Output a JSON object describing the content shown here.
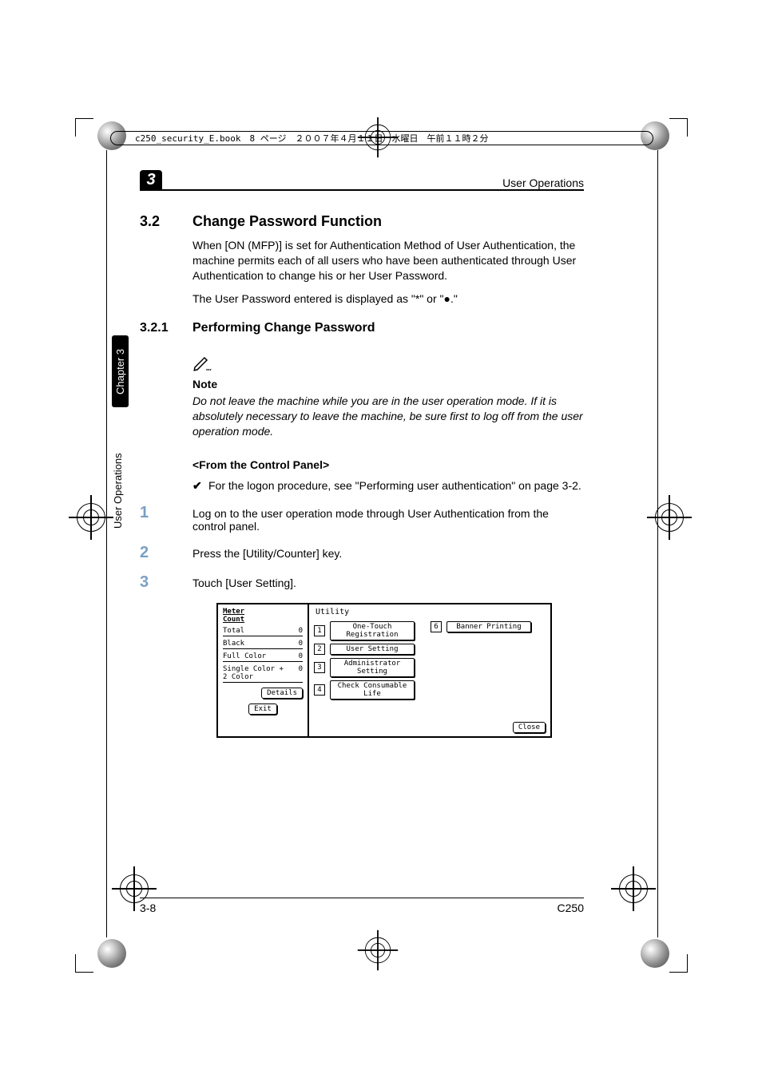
{
  "file_header": "c250_security_E.book　8 ページ　２００７年４月１１日　水曜日　午前１１時２分",
  "chapter_number": "3",
  "running_head": "User Operations",
  "section": {
    "number": "3.2",
    "title": "Change Password Function"
  },
  "paragraphs": [
    "When [ON (MFP)] is set for Authentication Method of User Authentication, the machine permits each of all users who have been authenticated through User Authentication to change his or her User Password.",
    "The User Password entered is displayed as \"*\" or \"●.\""
  ],
  "subsection": {
    "number": "3.2.1",
    "title": "Performing Change Password"
  },
  "note": {
    "label": "Note",
    "text": "Do not leave the machine while you are in the user operation mode. If it is absolutely necessary to leave the machine, be sure first to log off from the user operation mode."
  },
  "from_panel_heading": "<From the Control Panel>",
  "bullet_prereq": "For the logon procedure, see \"Performing user authentication\" on page 3-2.",
  "steps": [
    "Log on to the user operation mode through User Authentication from the control panel.",
    "Press the [Utility/Counter] key.",
    "Touch [User Setting]."
  ],
  "side_tabs": {
    "chapter": "Chapter 3",
    "title": "User Operations"
  },
  "footer": {
    "page": "3-8",
    "model": "C250"
  },
  "panel": {
    "meter": {
      "header": "Meter\nCount",
      "rows": [
        {
          "label": "Total",
          "value": "0"
        },
        {
          "label": "Black",
          "value": "0"
        },
        {
          "label": "Full Color",
          "value": "0"
        },
        {
          "label": "Single Color +\n2 Color",
          "value": "0"
        }
      ],
      "details_btn": "Details",
      "exit_btn": "Exit"
    },
    "utility": {
      "title": "Utility",
      "items": [
        {
          "num": "1",
          "label": "One-Touch\nRegistration"
        },
        {
          "num": "2",
          "label": "User Setting"
        },
        {
          "num": "3",
          "label": "Administrator\nSetting"
        },
        {
          "num": "4",
          "label": "Check Consumable\nLife"
        },
        {
          "num": "6",
          "label": "Banner Printing"
        }
      ],
      "close_btn": "Close"
    }
  }
}
